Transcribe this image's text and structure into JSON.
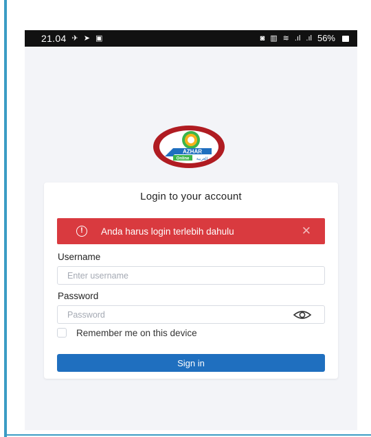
{
  "status_bar": {
    "time": "21.04",
    "left_icons": [
      "plane-icon",
      "send-icon",
      "notification-icon"
    ],
    "right_icons": [
      "alarm-icon",
      "vibrate-icon",
      "wifi-icon",
      "signal-icon",
      "signal-icon"
    ],
    "battery": "56%"
  },
  "logo": {
    "text": "AZHAR",
    "sub_text": "Online",
    "arabic_text": "العربية",
    "colors": {
      "ring": "#b01c22",
      "accent": "#3bb54a",
      "brand_blue": "#1f6fbf"
    }
  },
  "login": {
    "title": "Login to your account",
    "alert": {
      "message": "Anda harus login terlebih dahulu",
      "icon": "exclamation-circle-icon",
      "close_icon": "close-icon",
      "color": "#d93a3f"
    },
    "username_label": "Username",
    "username_placeholder": "Enter username",
    "username_value": "",
    "password_label": "Password",
    "password_placeholder": "Password",
    "password_value": "",
    "remember_label": "Remember me on this device",
    "remember_checked": false,
    "signin_label": "Sign in",
    "signin_color": "#1f6fbf"
  }
}
